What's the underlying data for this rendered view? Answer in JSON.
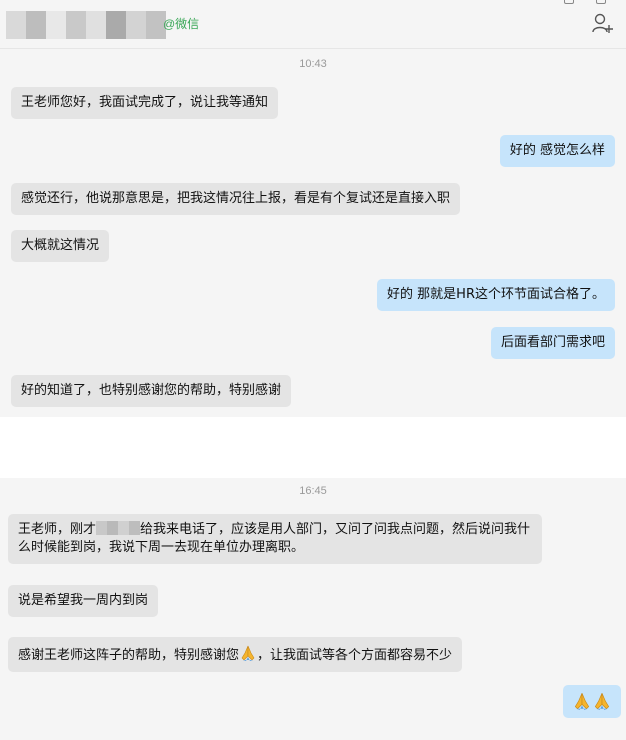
{
  "header": {
    "tag": "@微信"
  },
  "session1": {
    "time": "10:43",
    "messages": [
      {
        "side": "in",
        "text": "王老师您好，我面试完成了，说让我等通知"
      },
      {
        "side": "out",
        "text": "好的 感觉怎么样"
      },
      {
        "side": "in",
        "text": "感觉还行，他说那意思是，把我这情况往上报，看是有个复试还是直接入职"
      },
      {
        "side": "in",
        "text": "大概就这情况"
      },
      {
        "side": "out",
        "text": "好的 那就是HR这个环节面试合格了。"
      },
      {
        "side": "out",
        "text": "后面看部门需求吧"
      },
      {
        "side": "in",
        "text": "好的知道了，也特别感谢您的帮助，特别感谢"
      }
    ]
  },
  "session2": {
    "time": "16:45",
    "msg1_part1": "王老师，刚才",
    "msg1_part2": "给我来电话了，应该是用人部门，又问了问我点问题，然后说问我什",
    "msg1_line2": "么时候能到岗，我说下周一去现在单位办理离职。",
    "msg2": "说是希望我一周内到岗",
    "msg3_part1": "感谢王老师这阵子的帮助，特别感谢您",
    "msg3_part2": "，让我面试等各个方面都容易不少",
    "msg4_icon": "pray-icon"
  },
  "colors": {
    "incoming_bubble": "#e4e4e4",
    "outgoing_bubble": "#c6e4fb",
    "tag_green": "#3aa757",
    "chat_bg": "#f5f5f5"
  }
}
